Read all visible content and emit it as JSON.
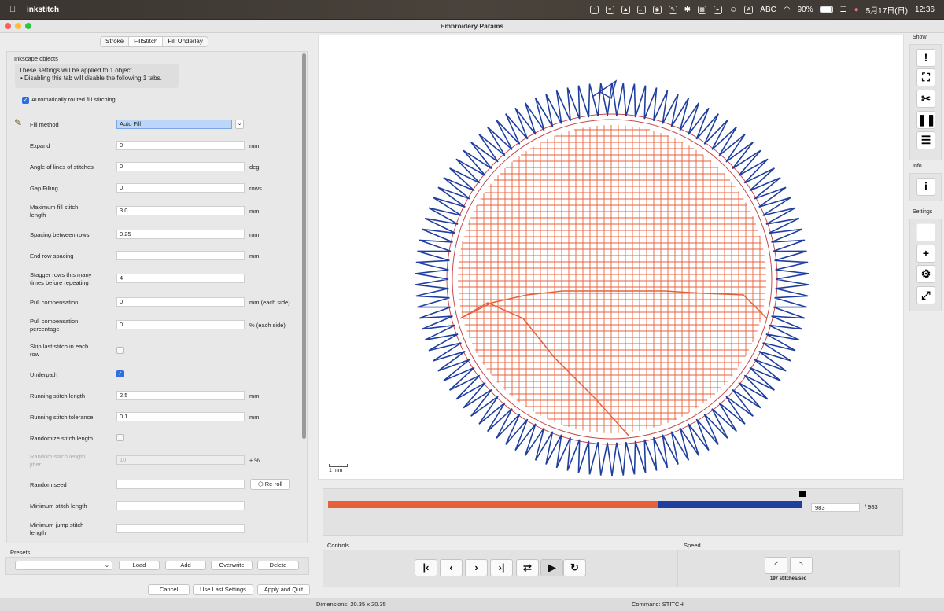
{
  "menubar": {
    "app_name": "inkstitch",
    "input_mode": "ABC",
    "battery": "90%",
    "date": "5月17日(日)",
    "time": "12:36"
  },
  "window": {
    "title": "Embroidery Params"
  },
  "tabs": [
    {
      "label": "Stroke",
      "active": false
    },
    {
      "label": "FillStitch",
      "active": true
    },
    {
      "label": "Fill Underlay",
      "active": false
    }
  ],
  "panel": {
    "header": "Inkscape objects",
    "info_line1": "These settings will be applied to 1 object.",
    "info_line2": "• Disabling this tab will disable the following 1 tabs.",
    "auto_routed_label": "Automatically routed fill stitching",
    "auto_routed_checked": true
  },
  "params": [
    {
      "label": "Fill method",
      "value": "Auto Fill",
      "unit": "",
      "type": "select"
    },
    {
      "label": "Expand",
      "value": "0",
      "unit": "mm",
      "type": "text"
    },
    {
      "label": "Angle of lines of stitches",
      "value": "0",
      "unit": "deg",
      "type": "text"
    },
    {
      "label": "Gap Filling",
      "value": "0",
      "unit": "rows",
      "type": "text"
    },
    {
      "label": "Maximum fill stitch length",
      "value": "3.0",
      "unit": "mm",
      "type": "text"
    },
    {
      "label": "Spacing between rows",
      "value": "0.25",
      "unit": "mm",
      "type": "text"
    },
    {
      "label": "End row spacing",
      "value": "",
      "unit": "mm",
      "type": "text"
    },
    {
      "label": "Stagger rows this many times before repeating",
      "value": "4",
      "unit": "",
      "type": "text"
    },
    {
      "label": "Pull compensation",
      "value": "0",
      "unit": "mm (each side)",
      "type": "text"
    },
    {
      "label": "Pull compensation percentage",
      "value": "0",
      "unit": "% (each side)",
      "type": "text"
    },
    {
      "label": "Skip last stitch in each row",
      "checked": false,
      "type": "check"
    },
    {
      "label": "Underpath",
      "checked": true,
      "type": "check"
    },
    {
      "label": "Running stitch length",
      "value": "2.5",
      "unit": "mm",
      "type": "text"
    },
    {
      "label": "Running stitch tolerance",
      "value": "0.1",
      "unit": "mm",
      "type": "text"
    },
    {
      "label": "Randomize stitch length",
      "checked": false,
      "type": "check"
    },
    {
      "label": "Random stitch length jitter",
      "value": "10",
      "unit": "± %",
      "type": "text",
      "disabled": true
    },
    {
      "label": "Random seed",
      "value": "",
      "unit": "",
      "type": "text",
      "reroll": "Re-roll"
    },
    {
      "label": "Minimum stitch length",
      "value": "",
      "unit": "",
      "type": "text"
    },
    {
      "label": "Minimum jump stitch length",
      "value": "",
      "unit": "",
      "type": "text"
    }
  ],
  "presets": {
    "label": "Presets",
    "selected": "",
    "load": "Load",
    "add": "Add",
    "overwrite": "Overwrite",
    "delete": "Delete"
  },
  "actions": {
    "cancel": "Cancel",
    "use_last": "Use Last Settings",
    "apply_quit": "Apply and Quit"
  },
  "preview": {
    "scale_label": "1 mm"
  },
  "timeline": {
    "current_frame": "983",
    "total": "/ 983",
    "progress_fraction": 1.0,
    "orange_fraction": 0.695
  },
  "controls": {
    "title": "Controls"
  },
  "speed": {
    "title": "Speed",
    "value": "197 stitches/sec"
  },
  "sidebar": {
    "show_label": "Show",
    "info_label": "Info",
    "settings_label": "Settings"
  },
  "status": {
    "dimensions": "Dimensions: 20.35 x 20.35",
    "command": "Command: STITCH"
  },
  "colors": {
    "fill_stitch": "#e8603a",
    "satin_stitch": "#1f3fa0",
    "checkbox_on": "#2f6ee0"
  }
}
